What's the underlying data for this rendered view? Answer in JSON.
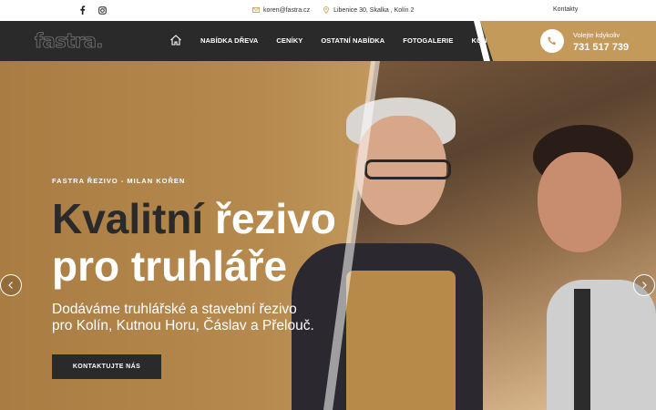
{
  "topbar": {
    "email": "koren@fastra.cz",
    "address": "Libenice 30, Skalka , Kolín 2",
    "kontakty": "Kontakty"
  },
  "nav": {
    "logo": "fastra.",
    "items": [
      "NABÍDKA DŘEVA",
      "CENÍKY",
      "OSTATNÍ NABÍDKA",
      "FOTOGALERIE",
      "KONTAKT"
    ],
    "call_label": "Volejte kdykoliv",
    "call_number": "731 517 739"
  },
  "hero": {
    "eyebrow": "FASTRA ŘEZIVO - MILAN KOŘEN",
    "headline_word1": "Kvalitní",
    "headline_word2": "řezivo",
    "headline_line2": "pro truhláře",
    "sub_line1": "Dodáváme truhlářské a stavební řezivo",
    "sub_line2": "pro Kolín, Kutnou Horu, Čáslav a Přelouč.",
    "cta": "KONTAKTUJTE NÁS"
  },
  "colors": {
    "accent": "#c49a5a",
    "dark": "#2a2a2a"
  }
}
